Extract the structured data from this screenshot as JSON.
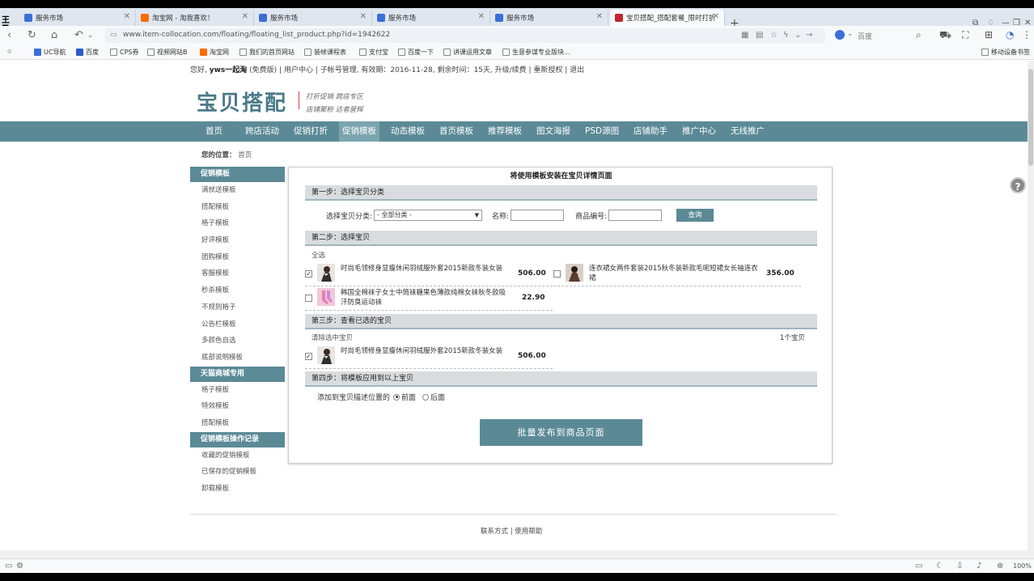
{
  "browser": {
    "tabs": [
      {
        "label": "服务市场",
        "icon_color": "#3a6fd8"
      },
      {
        "label": "淘宝网 - 淘我喜欢！",
        "icon_color": "#ff6a00"
      },
      {
        "label": "服务市场",
        "icon_color": "#3a6fd8"
      },
      {
        "label": "服务市场",
        "icon_color": "#3a6fd8"
      },
      {
        "label": "服务市场",
        "icon_color": "#3a6fd8"
      },
      {
        "label": "宝贝搭配_搭配套餐_限时打折",
        "icon_color": "#c0282d"
      }
    ],
    "url": "www.item-collocation.com/floating/floating_list_product.php?id=1942622",
    "search_engine": "百度",
    "zoom": "100%",
    "bookmarks": [
      "UC导航",
      "百度",
      "CPS券",
      "视频网站B",
      "淘宝网",
      "我们的首页网站",
      "装帧课程表",
      "支付宝",
      "百度一下",
      "讲课运用文章",
      "生意参谋专业版块..."
    ],
    "mobile_bookmarks": "移动设备书签"
  },
  "header": {
    "greeting_prefix": "您好,",
    "username": "yws一起淘",
    "user_info": "(免费版) | 用户中心 | 子帐号管理, 有效期：2016-11-28, 剩余时间：15天, 升级/续费 | 重新授权 | 退出",
    "logo": "宝贝搭配",
    "slogan_line1": "打折促销 跨店专区",
    "slogan_line2": "店铺聚粉 达者营辉"
  },
  "nav": [
    "首页",
    "跨店活动",
    "促销打折",
    "促销模板",
    "动态模板",
    "首页模板",
    "推荐模板",
    "图文海报",
    "PSD源图",
    "店铺助手",
    "推广中心",
    "无线推广"
  ],
  "nav_active": 3,
  "breadcrumb": {
    "label": "您的位置：",
    "value": "首页"
  },
  "sidebar": {
    "sections": [
      {
        "title": "促销模板",
        "items": [
          "满就送模板",
          "搭配模板",
          "格子模板",
          "好评模板",
          "团购模板",
          "客服模板",
          "秒杀模板",
          "不规则格子",
          "公告栏模板",
          "多颜色自选",
          "底部说明模板"
        ]
      },
      {
        "title": "天猫商城专用",
        "items": [
          "格子模板",
          "特效模板",
          "搭配模板"
        ]
      },
      {
        "title": "促销模板操作记录",
        "items": [
          "收藏的促销模板",
          "已保存的促销模板",
          "卸载模板"
        ]
      }
    ]
  },
  "panel": {
    "title": "将使用模板安装在宝贝详情页面",
    "step1": "第一步：选择宝贝分类",
    "category_label": "选择宝贝分类:",
    "category_value": "- 全部分类 -",
    "name_label": "名称:",
    "code_label": "商品编号:",
    "query_button": "查询",
    "step2": "第二步：选择宝贝",
    "select_all": "全选",
    "products": [
      {
        "name": "时尚毛领修身显瘦休闲羽绒服外套2015新款冬装女装",
        "price": "506.00",
        "checked": true
      },
      {
        "name": "连衣裙女两件套装2015秋冬装新款毛呢短裙女长袖连衣裙",
        "price": "356.00",
        "checked": false
      },
      {
        "name": "韩国全棉袜子女士中筒袜糖果色薄款纯棉女袜秋冬款吸汗防臭运动袜",
        "price": "22.90",
        "checked": false
      }
    ],
    "step3": "第三步：查看已选的宝贝",
    "clear_selected": "清除选中宝贝",
    "selected_count": "1个宝贝",
    "selected_products": [
      {
        "name": "时尚毛领修身显瘦休闲羽绒服外套2015新款冬装女装",
        "price": "506.00",
        "checked": true
      }
    ],
    "step4": "第四步：将模板应用到以上宝贝",
    "position_label": "添加到宝贝描述位置的",
    "position_front": "前面",
    "position_back": "后面",
    "position_selected": "前面",
    "publish_button": "批量发布到商品页面"
  },
  "footer": "联系方式 | 使用帮助",
  "colors": {
    "accent": "#5b8a96",
    "step_bg": "#d9dcdf"
  }
}
